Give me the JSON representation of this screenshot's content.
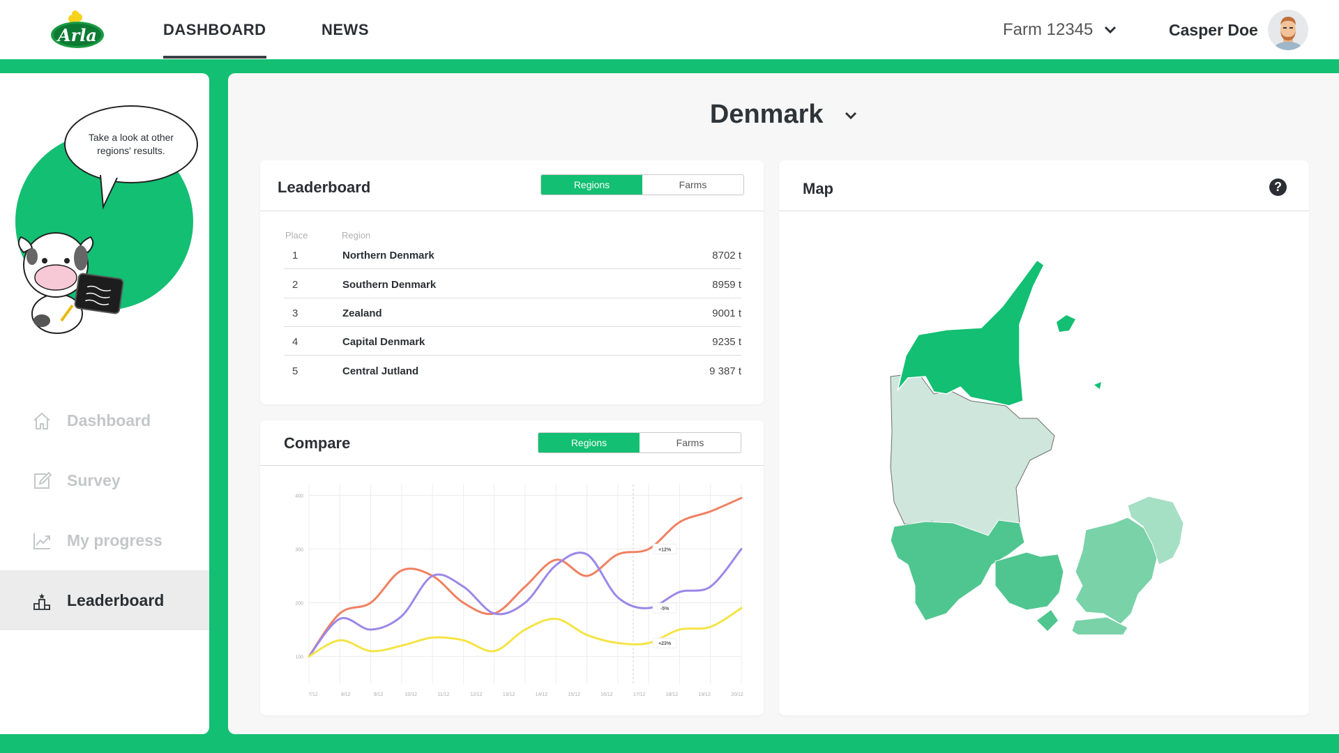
{
  "header": {
    "logo_text": "Arla",
    "nav": [
      {
        "label": "DASHBOARD",
        "active": true
      },
      {
        "label": "NEWS",
        "active": false
      }
    ],
    "farm": "Farm 12345",
    "user_name": "Casper Doe"
  },
  "sidebar": {
    "bubble_text": "Take a look at other regions' results.",
    "items": [
      {
        "label": "Dashboard",
        "icon": "home-icon",
        "active": false
      },
      {
        "label": "Survey",
        "icon": "edit-icon",
        "active": false
      },
      {
        "label": "My progress",
        "icon": "trend-icon",
        "active": false
      },
      {
        "label": "Leaderboard",
        "icon": "podium-icon",
        "active": true
      }
    ]
  },
  "main": {
    "country": "Denmark",
    "leaderboard": {
      "title": "Leaderboard",
      "toggle": [
        "Regions",
        "Farms"
      ],
      "headers": {
        "place": "Place",
        "region": "Region"
      },
      "rows": [
        {
          "place": "1",
          "region": "Northern Denmark",
          "value": "8702 t"
        },
        {
          "place": "2",
          "region": "Southern Denmark",
          "value": "8959 t"
        },
        {
          "place": "3",
          "region": "Zealand",
          "value": "9001 t"
        },
        {
          "place": "4",
          "region": "Capital Denmark",
          "value": "9235 t"
        },
        {
          "place": "5",
          "region": "Central Jutland",
          "value": "9 387 t"
        }
      ]
    },
    "compare": {
      "title": "Compare",
      "toggle": [
        "Regions",
        "Farms"
      ]
    },
    "map": {
      "title": "Map"
    }
  },
  "colors": {
    "accent": "#13bf72",
    "orange": "#f08060",
    "purple": "#9b87e8",
    "yellow": "#f5e445"
  },
  "chart_data": {
    "type": "line",
    "title": "",
    "xlabel": "",
    "ylabel": "",
    "ylim": [
      50,
      420
    ],
    "y_ticks": [
      "400",
      "300",
      "200",
      "100"
    ],
    "x": [
      1,
      2,
      3,
      4,
      5,
      6,
      7,
      8,
      9,
      10,
      11,
      12,
      13,
      14,
      15
    ],
    "x_ticks": [
      "7/12",
      "8/12",
      "9/12",
      "10/12",
      "11/12",
      "12/12",
      "13/12",
      "14/12",
      "15/12",
      "16/12",
      "17/12",
      "18/12",
      "19/12",
      "20/12"
    ],
    "series": [
      {
        "color": "#f08060",
        "values": [
          100,
          180,
          200,
          260,
          250,
          200,
          180,
          230,
          280,
          250,
          290,
          300,
          350,
          370,
          395
        ]
      },
      {
        "color": "#9b87e8",
        "values": [
          100,
          170,
          150,
          175,
          250,
          230,
          180,
          200,
          270,
          290,
          210,
          190,
          220,
          230,
          300
        ]
      },
      {
        "color": "#f5e445",
        "values": [
          100,
          130,
          110,
          120,
          135,
          130,
          110,
          150,
          170,
          140,
          125,
          125,
          150,
          155,
          190
        ]
      }
    ],
    "annotations": [
      "+12%",
      "-5%",
      "+23%"
    ]
  }
}
